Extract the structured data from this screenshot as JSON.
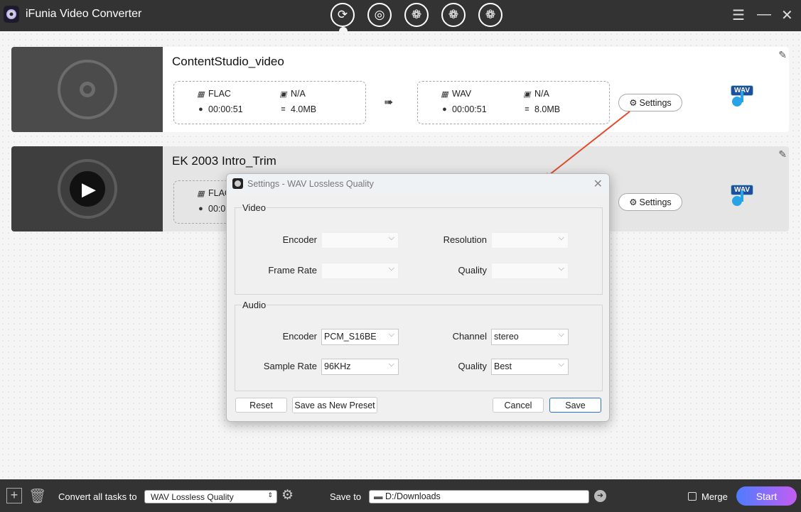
{
  "app": {
    "title": "iFunia Video Converter"
  },
  "nav_icons": [
    "convert-icon",
    "audio-convert-icon",
    "video-download-icon",
    "video-merge-icon",
    "video-edit-icon"
  ],
  "tasks": [
    {
      "name": "ContentStudio_video",
      "src": {
        "format": "FLAC",
        "resolution": "N/A",
        "duration": "00:00:51",
        "size": "4.0MB"
      },
      "dst": {
        "format": "WAV",
        "resolution": "N/A",
        "duration": "00:00:51",
        "size": "8.0MB"
      },
      "settings_label": "Settings",
      "badge": "WAV"
    },
    {
      "name": "EK 2003 Intro_Trim",
      "src": {
        "format": "FLAC",
        "duration": "00:0"
      },
      "settings_label": "Settings",
      "badge": "WAV"
    }
  ],
  "dialog": {
    "title": "Settings - WAV Lossless Quality",
    "video": {
      "legend": "Video",
      "encoder_label": "Encoder",
      "encoder": "",
      "resolution_label": "Resolution",
      "resolution": "",
      "frame_rate_label": "Frame Rate",
      "frame_rate": "",
      "quality_label": "Quality",
      "quality": ""
    },
    "audio": {
      "legend": "Audio",
      "encoder_label": "Encoder",
      "encoder": "PCM_S16BE",
      "channel_label": "Channel",
      "channel": "stereo",
      "sample_rate_label": "Sample Rate",
      "sample_rate": "96KHz",
      "quality_label": "Quality",
      "quality": "Best"
    },
    "buttons": {
      "reset": "Reset",
      "save_preset": "Save as New Preset",
      "cancel": "Cancel",
      "save": "Save"
    }
  },
  "bottom": {
    "convert_label": "Convert all tasks to",
    "preset": "WAV Lossless Quality",
    "save_to_label": "Save to",
    "path": "D:/Downloads",
    "merge_label": "Merge",
    "merge_checked": false,
    "start": "Start"
  },
  "colors": {
    "titlebar": "#333333",
    "accent_arrow": "#e04a2a",
    "start_gradient_from": "#4d7dff",
    "start_gradient_to": "#c55cf2"
  }
}
